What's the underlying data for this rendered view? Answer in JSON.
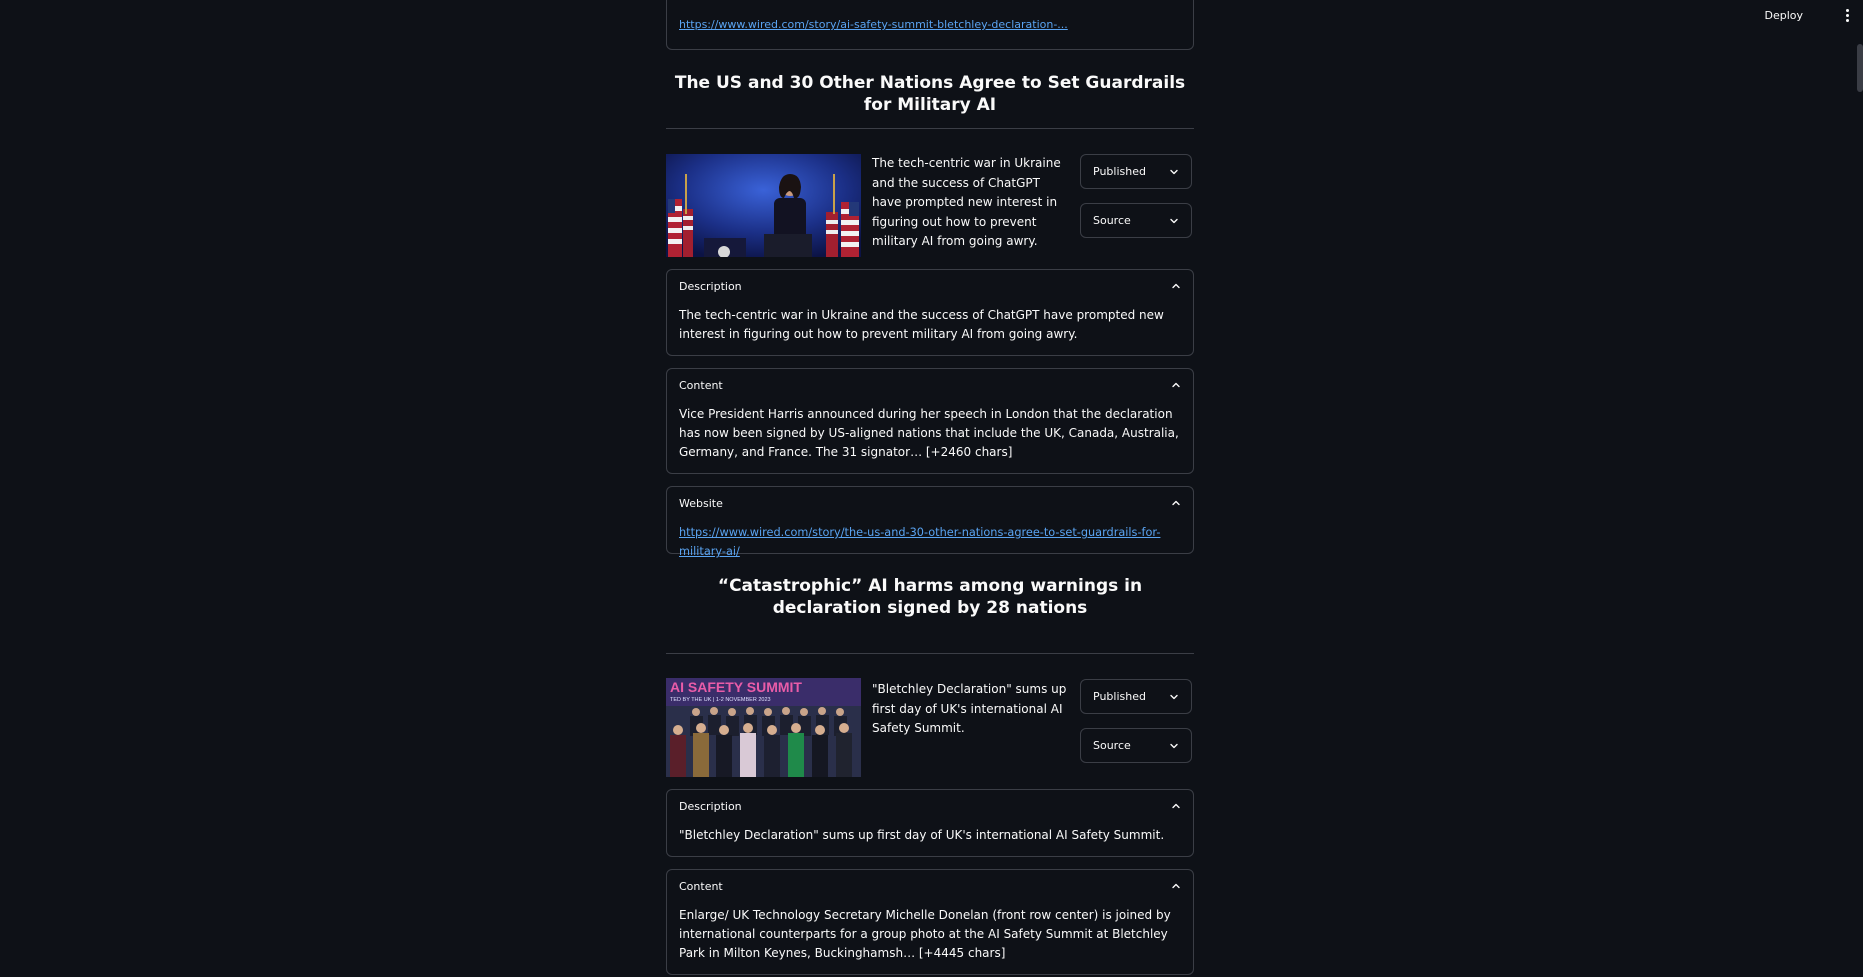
{
  "header": {
    "deploy_label": "Deploy",
    "menu_icon": "kebab-menu-icon"
  },
  "previous_article": {
    "link": "https://www.wired.com/story/ai-safety-summit-bletchley-declaration-..."
  },
  "articles": [
    {
      "title": "The US and 30 Other Nations Agree to Set Guardrails for Military AI",
      "summary": "The tech-centric war in Ukraine and the success of ChatGPT have prompted new interest in figuring out how to prevent military AI from going awry.",
      "published_label": "Published",
      "source_label": "Source",
      "description_label": "Description",
      "description": "The tech-centric war in Ukraine and the success of ChatGPT have prompted new interest in figuring out how to prevent military AI from going awry.",
      "content_label": "Content",
      "content": "Vice President Harris announced during her speech in London that the declaration has now been signed by US-aligned nations that include the UK, Canada, Australia, Germany, and France. The 31 signator… [+2460 chars]",
      "website_label": "Website",
      "website": "https://www.wired.com/story/the-us-and-30-other-nations-agree-to-set-guardrails-for-military-ai/"
    },
    {
      "title": "“Catastrophic” AI harms among warnings in declaration signed by 28 nations",
      "summary": "\"Bletchley Declaration\" sums up first day of UK's international AI Safety Summit.",
      "published_label": "Published",
      "source_label": "Source",
      "description_label": "Description",
      "description": "\"Bletchley Declaration\" sums up first day of UK's international AI Safety Summit.",
      "content_label": "Content",
      "content": "Enlarge/ UK Technology Secretary Michelle Donelan (front row center) is joined by international counterparts for a group photo at the AI Safety Summit at Bletchley Park in Milton Keynes, Buckinghamsh… [+4445 chars]",
      "image_banner_title": "AI SAFETY SUMMIT",
      "image_banner_sub": "TED BY THE UK | 1-2 NOVEMBER 2023"
    }
  ]
}
